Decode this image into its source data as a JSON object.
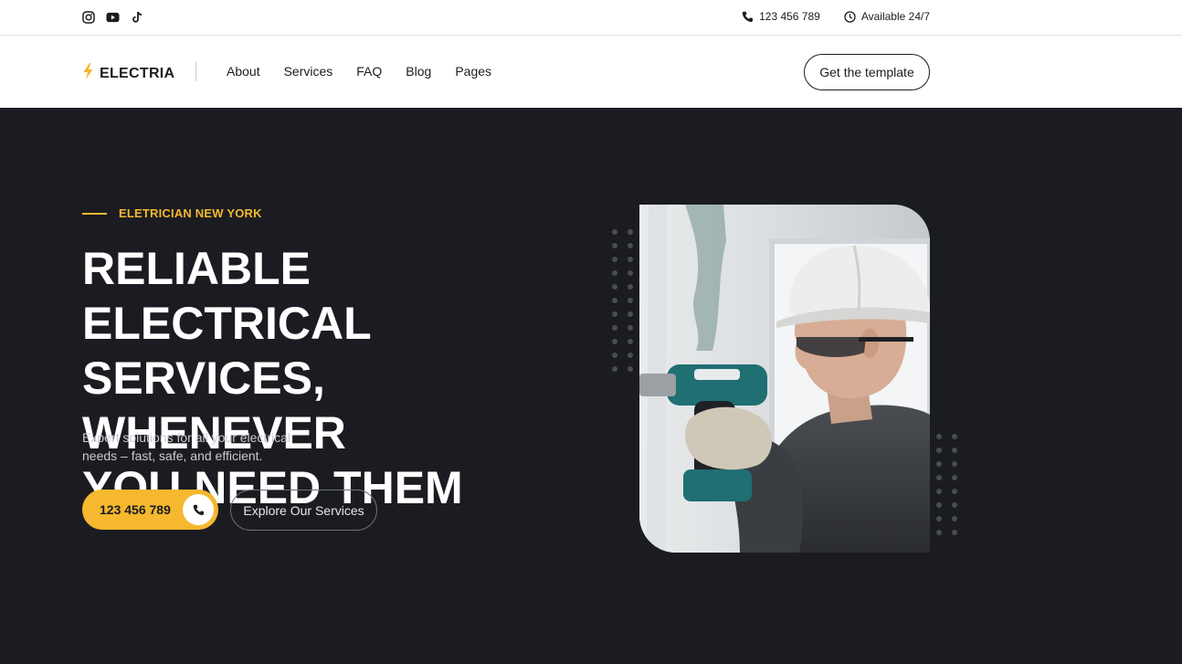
{
  "topbar": {
    "socials": [
      {
        "icon": "instagram-icon"
      },
      {
        "icon": "youtube-icon"
      },
      {
        "icon": "tiktok-icon"
      }
    ],
    "phone": "123 456 789",
    "availability": "Available 24/7"
  },
  "navbar": {
    "logo": "ELECTRIA",
    "links": [
      "About",
      "Services",
      "FAQ",
      "Blog",
      "Pages"
    ],
    "cta": "Get the template"
  },
  "hero": {
    "eyebrow": "ELETRICIAN NEW YORK",
    "headline_line1": "RELIABLE ELECTRICAL",
    "headline_line2": "SERVICES, WHENEVER",
    "headline_line3": "YOU NEED THEM",
    "subtitle": "Expert solutions for all your electrical needs – fast, safe, and efficient.",
    "phone_button": "123 456 789",
    "explore_button": "Explore Our Services"
  },
  "colors": {
    "accent": "#f5b82e",
    "dark_bg": "#1b1c21",
    "text_dark": "#1b1c21"
  }
}
